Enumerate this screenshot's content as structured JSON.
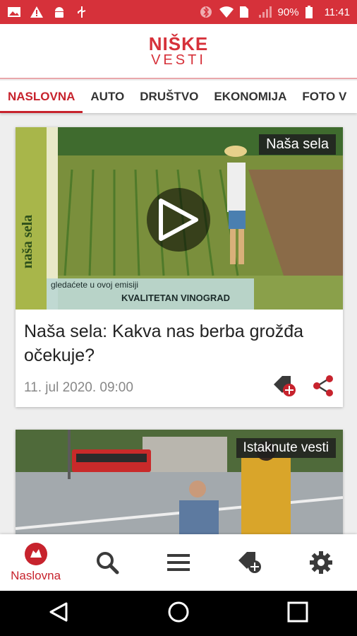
{
  "status_bar": {
    "battery": "90%",
    "time": "11:41"
  },
  "header": {
    "logo_top": "NIŠKE",
    "logo_bottom": "VESTI"
  },
  "tabs": [
    {
      "label": "NASLOVNA",
      "active": true
    },
    {
      "label": "AUTO"
    },
    {
      "label": "DRUŠTVO"
    },
    {
      "label": "EKONOMIJA"
    },
    {
      "label": "FOTO V"
    }
  ],
  "articles": [
    {
      "badge": "Naša sela",
      "overlay_side": "naša sela",
      "overlay_caption": "gledaćete u ovoj emisiji",
      "overlay_subject": "KVALITETAN VINOGRAD",
      "title": "Naša sela: Kakva nas berba grožđa očekuje?",
      "date": "11. jul 2020. 09:00"
    },
    {
      "badge": "Istaknute vesti"
    }
  ],
  "bottom_nav": {
    "home_label": "Naslovna"
  },
  "colors": {
    "brand": "#d6313a",
    "accent": "#c7232d"
  },
  "icons": [
    "gallery-icon",
    "warning-icon",
    "android-icon",
    "usb-icon",
    "bluetooth-icon",
    "wifi-icon",
    "sim-icon",
    "signal-icon",
    "battery-icon",
    "play-icon",
    "bookmark-add-icon",
    "share-icon",
    "logo-icon",
    "search-icon",
    "menu-icon",
    "bookmark-icon",
    "gear-icon",
    "back-icon",
    "home-icon",
    "recents-icon"
  ]
}
